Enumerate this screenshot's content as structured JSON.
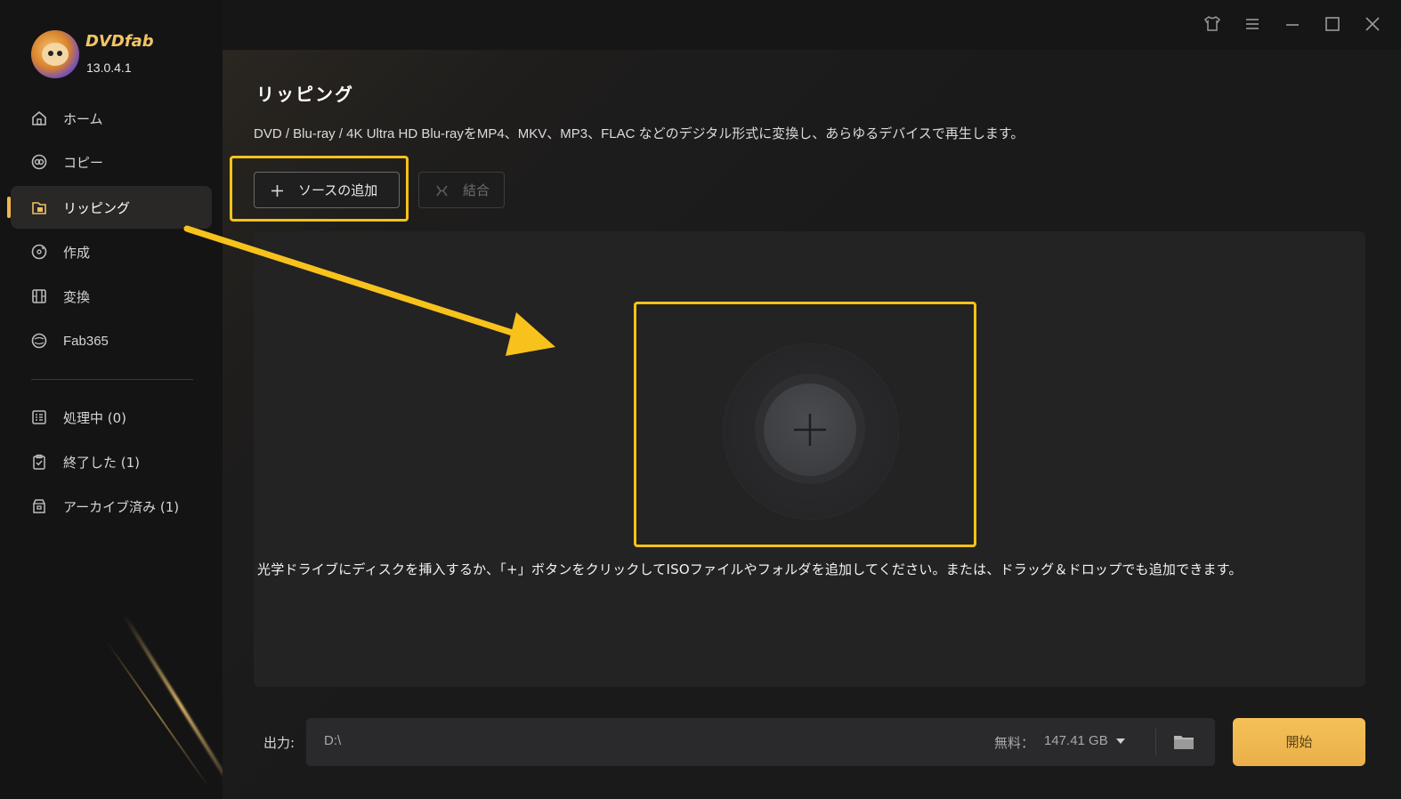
{
  "app": {
    "brand": "DVDfab",
    "version": "13.0.4.1"
  },
  "sidebar": {
    "items": [
      {
        "label": "ホーム",
        "icon": "home-icon"
      },
      {
        "label": "コピー",
        "icon": "copy-disc-icon"
      },
      {
        "label": "リッピング",
        "icon": "ripper-icon",
        "active": true
      },
      {
        "label": "作成",
        "icon": "creator-disc-icon"
      },
      {
        "label": "変換",
        "icon": "film-icon"
      },
      {
        "label": "Fab365",
        "icon": "fab365-icon"
      }
    ],
    "tasks": [
      {
        "label": "処理中 (0)",
        "icon": "processing-list-icon"
      },
      {
        "label": "終了した (1)",
        "icon": "finished-clipboard-icon"
      },
      {
        "label": "アーカイブ済み (1)",
        "icon": "archive-box-icon"
      }
    ]
  },
  "window_controls": [
    "skin-icon",
    "menu-icon",
    "minimize-icon",
    "maximize-icon",
    "close-icon"
  ],
  "main": {
    "title": "リッピング",
    "subtitle": "DVD / Blu-ray / 4K Ultra HD Blu-rayをMP4、MKV、MP3、FLAC などのデジタル形式に変換し、あらゆるデバイスで再生します。",
    "add_source_label": "ソースの追加",
    "merge_label": "結合",
    "dropzone_hint": "光学ドライブにディスクを挿入するか、「+」ボタンをクリックしてISOファイルやフォルダを追加してください。または、ドラッグ＆ドロップでも追加できます。"
  },
  "output": {
    "label": "出力:",
    "path": "D:\\",
    "free_label": "無料：",
    "free_value": "147.41 GB",
    "start_label": "開始"
  },
  "colors": {
    "accent": "#f0b84a",
    "highlight": "#f6c21a",
    "arrow": "#f8c21c"
  }
}
